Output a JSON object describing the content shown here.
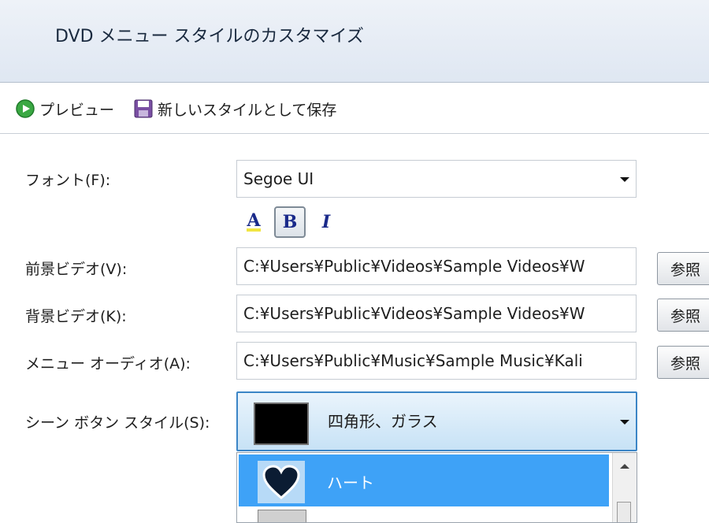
{
  "window": {
    "title": "DVD メニュー スタイルのカスタマイズ"
  },
  "toolbar": {
    "preview_label": "プレビュー",
    "save_label": "新しいスタイルとして保存"
  },
  "form": {
    "font_label": "フォント(F):",
    "font_value": "Segoe UI",
    "foreground_label": "前景ビデオ(V):",
    "foreground_value": "C:¥Users¥Public¥Videos¥Sample Videos¥W",
    "background_label": "背景ビデオ(K):",
    "background_value": "C:¥Users¥Public¥Videos¥Sample Videos¥W",
    "audio_label": "メニュー オーディオ(A):",
    "audio_value": "C:¥Users¥Public¥Music¥Sample Music¥Kali",
    "browse_label": "参照",
    "scene_button_label": "シーン ボタン スタイル(S):",
    "scene_button_value": "四角形、ガラス",
    "format_buttons": {
      "color": "A",
      "bold": "B",
      "italic": "I"
    }
  },
  "dropdown": {
    "items": [
      {
        "label": "ハート",
        "selected": true
      }
    ]
  },
  "colors": {
    "accent": "#3ea2f7",
    "title_bg": "#e4ebf5"
  }
}
